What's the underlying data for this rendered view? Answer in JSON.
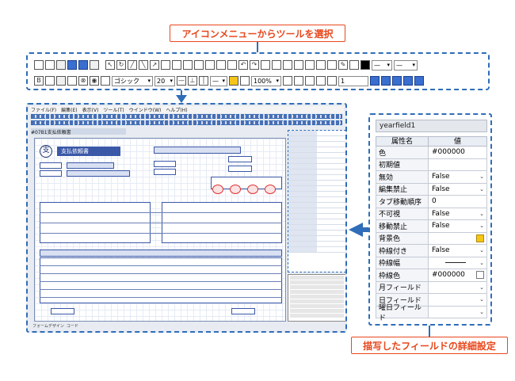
{
  "callouts": {
    "top": "アイコンメニューからツールを選択",
    "bottom": "描写したフィールドの詳細設定"
  },
  "toolbar": {
    "font_name": "ゴシック",
    "font_size": "20",
    "zoom": "100%",
    "page_value": "1"
  },
  "screen": {
    "menu": [
      "ファイル(F)",
      "編集(E)",
      "表示(V)",
      "ツール(T)",
      "ウインドウ(W)",
      "ヘルプ(H)"
    ],
    "doc_tab": "#07B1支払依頼書",
    "form_title": "支払依頼書",
    "bottom_tabs": [
      "フォームデザイン",
      "コード"
    ]
  },
  "property_panel": {
    "field_name": "yearfield1",
    "header_name": "属性名",
    "header_value": "値",
    "rows": [
      {
        "name": "色",
        "value": "#000000",
        "kind": "color-dark"
      },
      {
        "name": "初期値",
        "value": "",
        "kind": "text"
      },
      {
        "name": "無効",
        "value": "False",
        "kind": "dropdown"
      },
      {
        "name": "編集禁止",
        "value": "False",
        "kind": "dropdown"
      },
      {
        "name": "タブ移動順序",
        "value": "0",
        "kind": "text"
      },
      {
        "name": "不可視",
        "value": "False",
        "kind": "dropdown"
      },
      {
        "name": "移動禁止",
        "value": "False",
        "kind": "dropdown"
      },
      {
        "name": "背景色",
        "value": "",
        "kind": "color-yellow"
      },
      {
        "name": "枠線付き",
        "value": "False",
        "kind": "dropdown"
      },
      {
        "name": "枠線幅",
        "value": "",
        "kind": "line"
      },
      {
        "name": "枠線色",
        "value": "#000000",
        "kind": "color-white"
      },
      {
        "name": "月フィールド",
        "value": "",
        "kind": "dropdown"
      },
      {
        "name": "日フィールド",
        "value": "",
        "kind": "dropdown"
      },
      {
        "name": "曜日フィールド",
        "value": "",
        "kind": "dropdown"
      }
    ]
  },
  "colors": {
    "callout": "#e8471c",
    "dash": "#2f6db8"
  }
}
